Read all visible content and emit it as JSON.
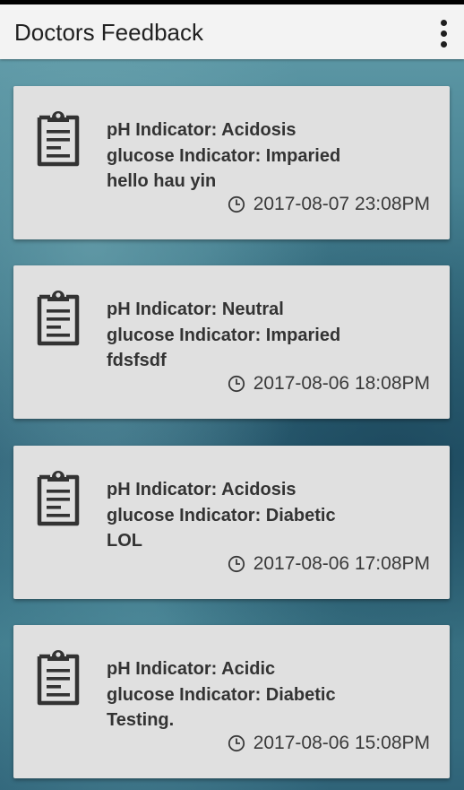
{
  "app_bar": {
    "title": "Doctors Feedback",
    "menu_icon": "more-vert-icon"
  },
  "feedback_items": [
    {
      "icon": "clipboard-icon",
      "ph": "pH Indicator: Acidosis",
      "glucose": "glucose Indicator: Imparied",
      "note": "hello hau yin",
      "time": "2017-08-07 23:08PM"
    },
    {
      "icon": "clipboard-icon",
      "ph": "pH Indicator: Neutral",
      "glucose": "glucose Indicator: Imparied",
      "note": "fdsfsdf",
      "time": "2017-08-06 18:08PM"
    },
    {
      "icon": "clipboard-icon",
      "ph": "pH Indicator: Acidosis",
      "glucose": "glucose Indicator: Diabetic",
      "note": "LOL",
      "time": "2017-08-06 17:08PM"
    },
    {
      "icon": "clipboard-icon",
      "ph": "pH Indicator: Acidic",
      "glucose": "glucose Indicator: Diabetic",
      "note": "Testing.",
      "time": "2017-08-06 15:08PM"
    }
  ],
  "colors": {
    "app_bar_background": "#f3f3f3",
    "card_background": "#e0e0e0",
    "text": "#333333",
    "background_teal": "#3c7688"
  }
}
